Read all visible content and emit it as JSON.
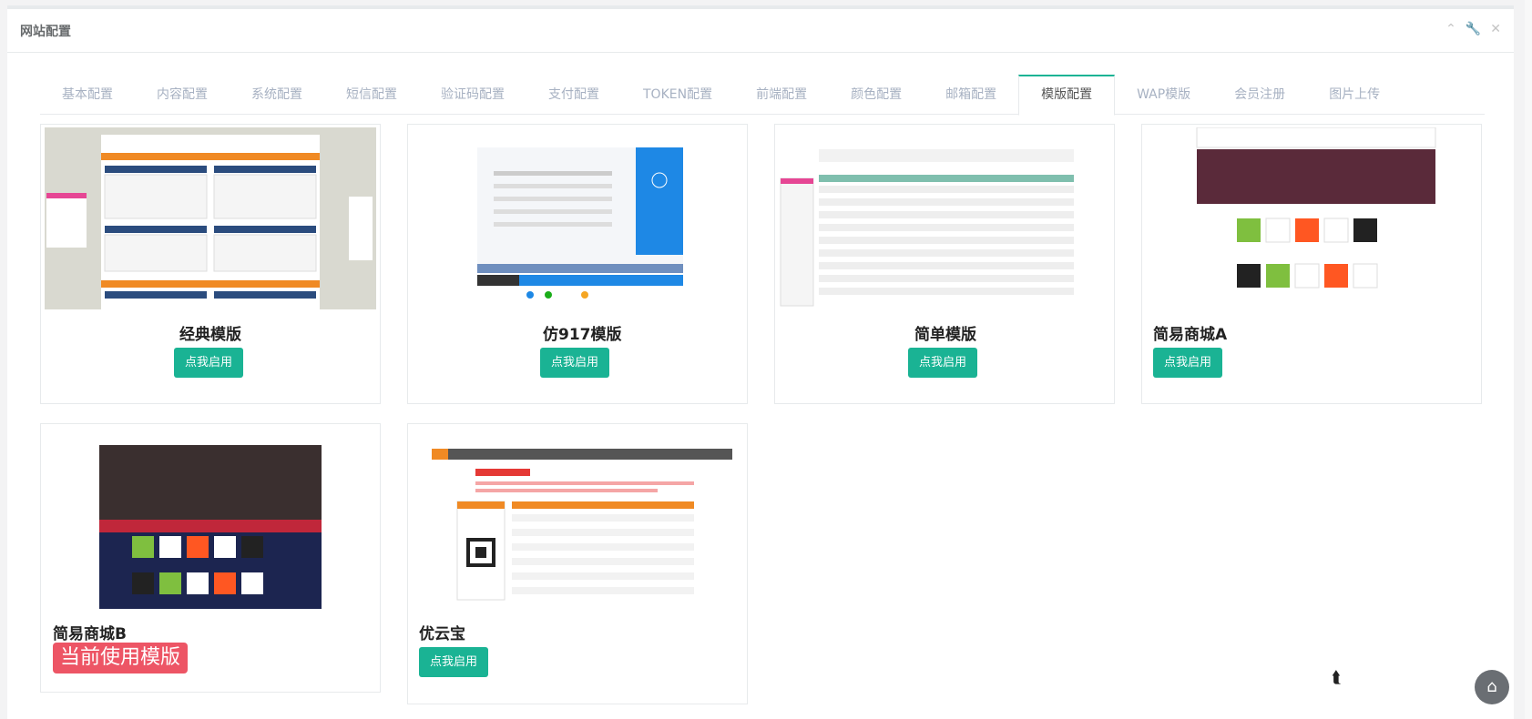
{
  "panel": {
    "title": "网站配置",
    "tools": {
      "collapse": "⌃",
      "settings": "🔧",
      "close": "✕"
    }
  },
  "tabs": [
    {
      "label": "基本配置"
    },
    {
      "label": "内容配置"
    },
    {
      "label": "系统配置"
    },
    {
      "label": "短信配置"
    },
    {
      "label": "验证码配置"
    },
    {
      "label": "支付配置"
    },
    {
      "label": "TOKEN配置"
    },
    {
      "label": "前端配置"
    },
    {
      "label": "颜色配置"
    },
    {
      "label": "邮箱配置"
    },
    {
      "label": "模版配置"
    },
    {
      "label": "WAP模版"
    },
    {
      "label": "会员注册"
    },
    {
      "label": "图片上传"
    }
  ],
  "active_tab": "模版配置",
  "templates": [
    {
      "name": "经典模版",
      "button": "点我启用"
    },
    {
      "name": "仿917模版",
      "button": "点我启用"
    },
    {
      "name": "简单模版",
      "button": "点我启用"
    },
    {
      "name": "简易商城A",
      "button": "点我启用"
    },
    {
      "name": "简易商城B",
      "current": "当前使用模版"
    },
    {
      "name": "优云宝",
      "button": "点我启用"
    }
  ],
  "colors": {
    "accent": "#1ab394",
    "current": "#ed5565"
  }
}
